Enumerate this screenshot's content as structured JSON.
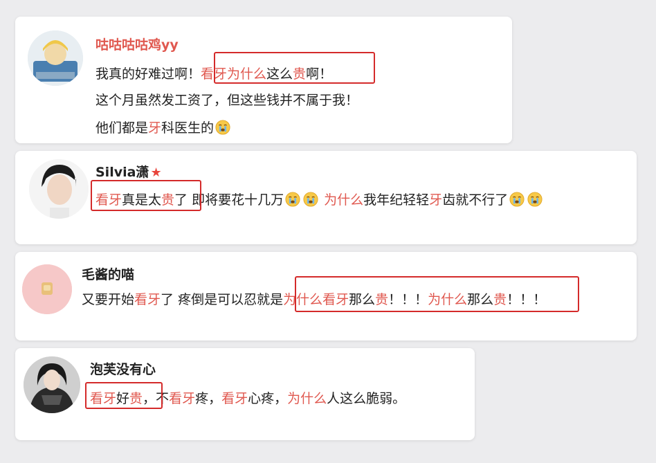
{
  "comments": [
    {
      "username": "咕咕咕咕鸡yy",
      "username_color": "#e0584f",
      "lines": [
        [
          {
            "t": "我真的好难过啊！"
          },
          {
            "t": "看牙为什么",
            "red": true
          },
          {
            "t": "这么"
          },
          {
            "t": "贵",
            "red": true
          },
          {
            "t": "啊！"
          }
        ],
        [
          {
            "t": "这个月虽然发工资了，但这些钱并不属于我！"
          }
        ],
        [
          {
            "t": "他们都是"
          },
          {
            "t": "牙",
            "red": true
          },
          {
            "t": "科医生的"
          },
          {
            "emoji": "crying-emoji"
          }
        ]
      ]
    },
    {
      "username": "Silvia潇",
      "username_color": "#222222",
      "badge": "★",
      "lines": [
        [
          {
            "t": "看牙",
            "red": true
          },
          {
            "t": "真是太"
          },
          {
            "t": "贵",
            "red": true
          },
          {
            "t": "了 即将要花十几万"
          },
          {
            "emoji": "crying-emoji"
          },
          {
            "emoji": "crying-emoji"
          },
          {
            "t": " "
          },
          {
            "t": "为什么",
            "red": true
          },
          {
            "t": "我年纪轻轻"
          },
          {
            "t": "牙",
            "red": true
          },
          {
            "t": "齿就不行了"
          },
          {
            "emoji": "crying-emoji"
          },
          {
            "emoji": "crying-emoji"
          }
        ]
      ]
    },
    {
      "username": "毛酱的喵",
      "username_color": "#222222",
      "lines": [
        [
          {
            "t": "又要开始"
          },
          {
            "t": "看牙",
            "red": true
          },
          {
            "t": "了 疼倒是可以忍就是"
          },
          {
            "t": "为什么看牙",
            "red": true
          },
          {
            "t": "那么"
          },
          {
            "t": "贵",
            "red": true
          },
          {
            "t": "！！！"
          },
          {
            "t": "为什么",
            "red": true
          },
          {
            "t": "那么"
          },
          {
            "t": "贵",
            "red": true
          },
          {
            "t": "！！！"
          }
        ]
      ]
    },
    {
      "username": "泡芙没有心",
      "username_color": "#222222",
      "lines": [
        [
          {
            "t": "看牙",
            "red": true
          },
          {
            "t": "好"
          },
          {
            "t": "贵",
            "red": true
          },
          {
            "t": "，不"
          },
          {
            "t": "看牙",
            "red": true
          },
          {
            "t": "疼，"
          },
          {
            "t": "看牙",
            "red": true
          },
          {
            "t": "心疼，"
          },
          {
            "t": "为什么",
            "red": true
          },
          {
            "t": "人这么脆弱。"
          }
        ]
      ]
    }
  ],
  "colors": {
    "highlight_text": "#e0584f",
    "box_border": "#d42a2a",
    "background": "#ececee"
  }
}
